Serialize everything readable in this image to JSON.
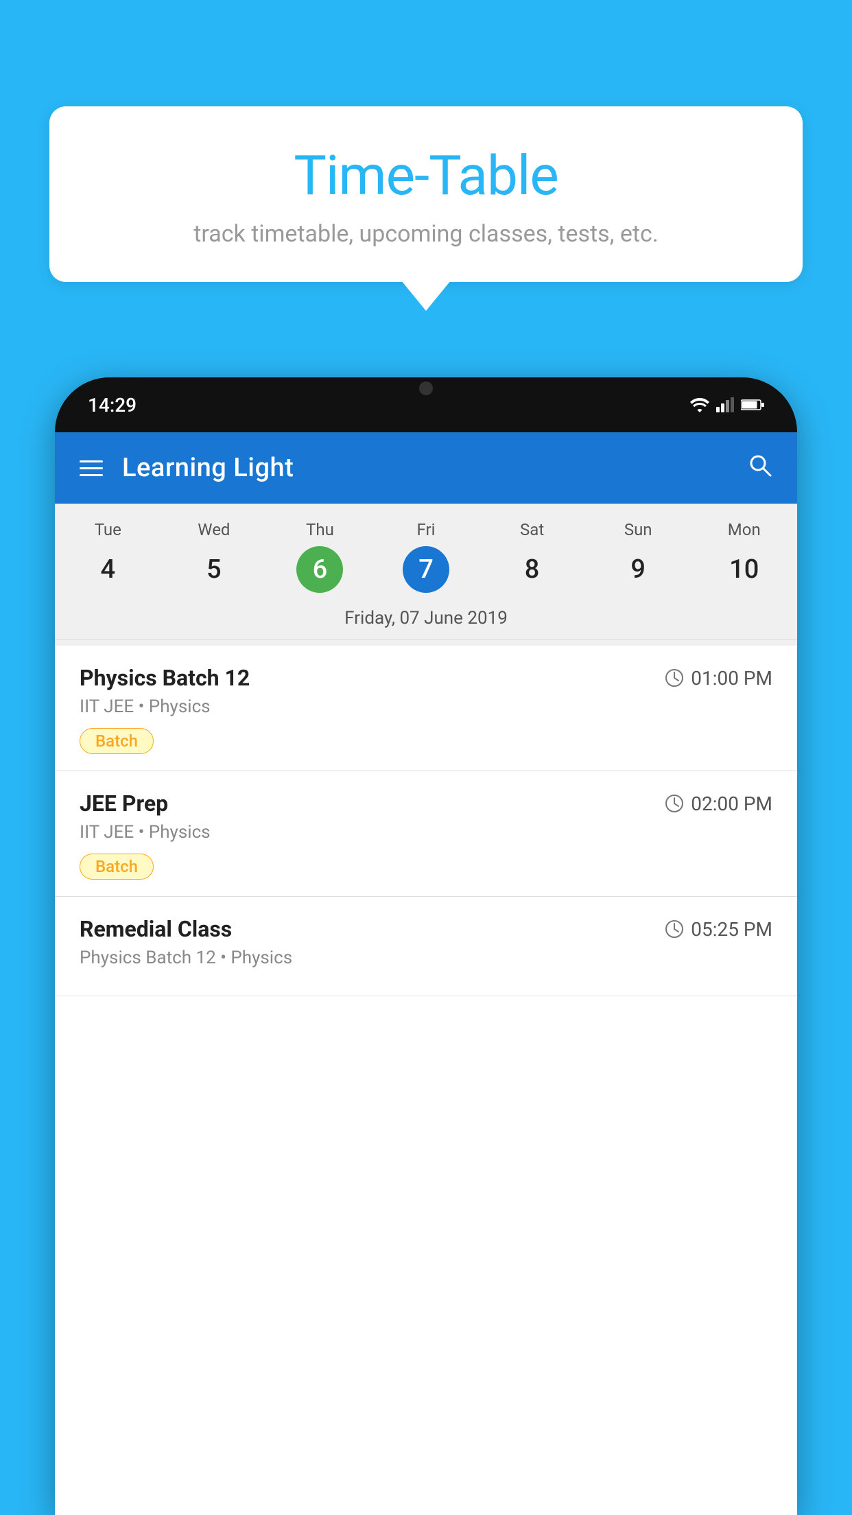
{
  "background_color": "#29B6F6",
  "speech_bubble": {
    "title": "Time-Table",
    "subtitle": "track timetable, upcoming classes, tests, etc."
  },
  "phone": {
    "time": "14:29",
    "app_bar": {
      "title": "Learning Light"
    },
    "calendar": {
      "days": [
        {
          "name": "Tue",
          "number": "4",
          "state": "normal"
        },
        {
          "name": "Wed",
          "number": "5",
          "state": "normal"
        },
        {
          "name": "Thu",
          "number": "6",
          "state": "today"
        },
        {
          "name": "Fri",
          "number": "7",
          "state": "selected"
        },
        {
          "name": "Sat",
          "number": "8",
          "state": "normal"
        },
        {
          "name": "Sun",
          "number": "9",
          "state": "normal"
        },
        {
          "name": "Mon",
          "number": "10",
          "state": "normal"
        }
      ],
      "selected_date_label": "Friday, 07 June 2019"
    },
    "classes": [
      {
        "name": "Physics Batch 12",
        "time": "01:00 PM",
        "subtitle": "IIT JEE • Physics",
        "tag": "Batch"
      },
      {
        "name": "JEE Prep",
        "time": "02:00 PM",
        "subtitle": "IIT JEE • Physics",
        "tag": "Batch"
      },
      {
        "name": "Remedial Class",
        "time": "05:25 PM",
        "subtitle": "Physics Batch 12 • Physics",
        "tag": ""
      }
    ]
  },
  "icons": {
    "menu": "☰",
    "search": "🔍",
    "clock": "🕐"
  }
}
